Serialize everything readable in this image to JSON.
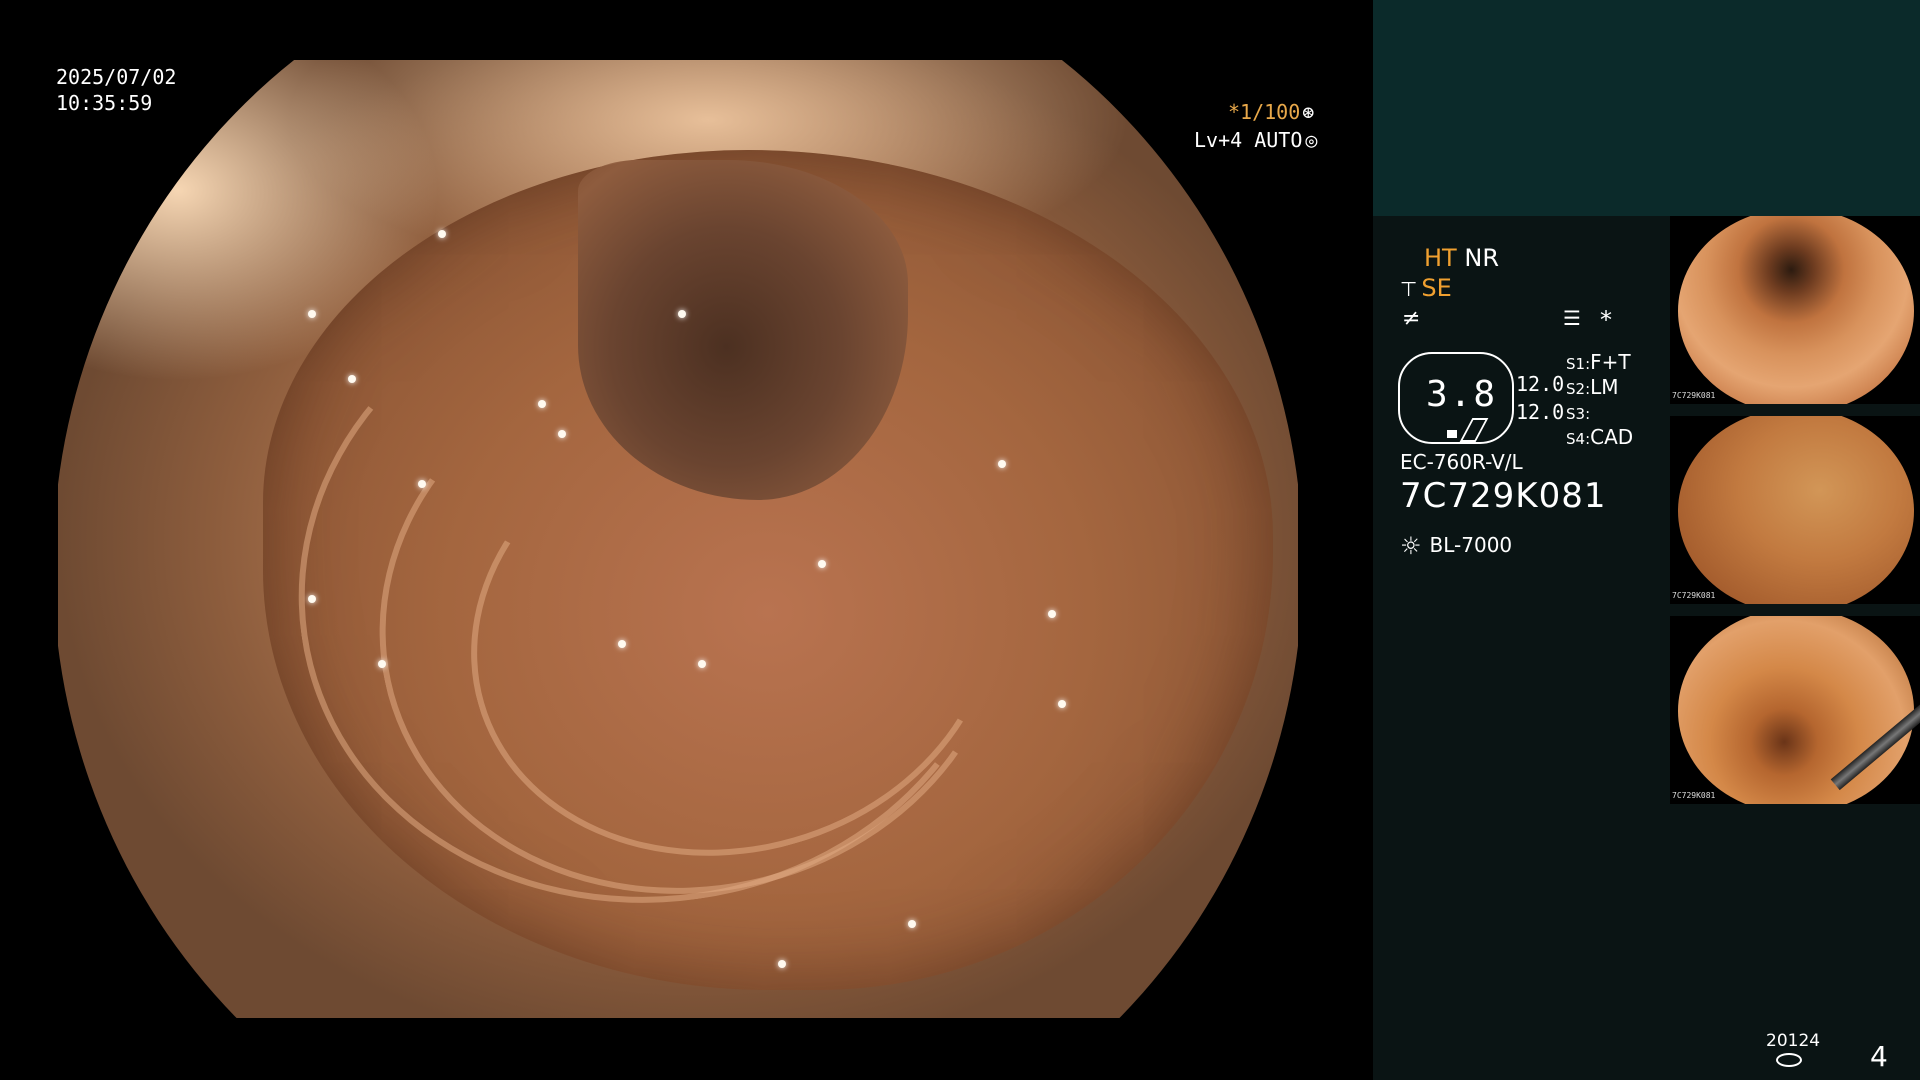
{
  "overlay": {
    "date": "2025/07/02",
    "time": "10:35:59",
    "shutter": "*1/100",
    "shutter_icon": "aperture-icon",
    "level": "Lv+4 AUTO",
    "level_icon": "iris-icon"
  },
  "settings": {
    "ht": "HT",
    "nr": "NR",
    "se": "SE",
    "se_icon": "structure-enhance-icon",
    "enhance_icon": "edge-enhance-icon",
    "menu_icon": "menu-icon",
    "star": "*"
  },
  "zoom": {
    "value": "3.8",
    "val1": "12.0",
    "val2": "12.0"
  },
  "switches": [
    {
      "key": "S1:",
      "value": "F+T"
    },
    {
      "key": "S2:",
      "value": "LM"
    },
    {
      "key": "S3:",
      "value": ""
    },
    {
      "key": "S4:",
      "value": "CAD"
    }
  ],
  "scope": {
    "model": "EC-760R-V/L",
    "serial": "7C729K081",
    "light_source": "BL-7000",
    "light_icon": "light-source-icon"
  },
  "thumbnails": [
    {
      "serial": "7C729K081"
    },
    {
      "serial": "7C729K081"
    },
    {
      "serial": "7C729K081"
    }
  ],
  "footer": {
    "count": "20124",
    "storage_icon": "storage-icon",
    "page": "4"
  }
}
